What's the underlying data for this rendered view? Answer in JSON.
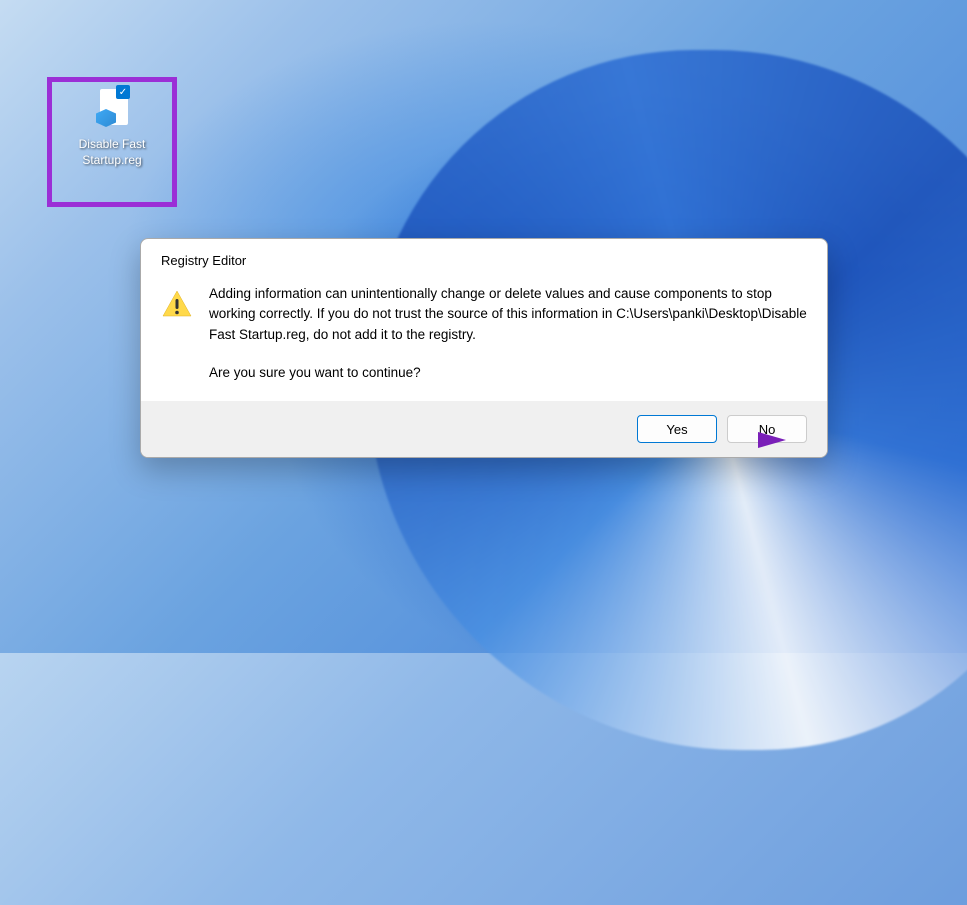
{
  "desktop": {
    "icon": {
      "label": "Disable Fast Startup.reg",
      "name": "reg-file-icon"
    }
  },
  "dialog": {
    "title": "Registry Editor",
    "warning_text": "Adding information can unintentionally change or delete values and cause components to stop working correctly. If you do not trust the source of this information in C:\\Users\\panki\\Desktop\\Disable Fast Startup.reg, do not add it to the registry.",
    "confirm_text": "Are you sure you want to continue?",
    "buttons": {
      "yes": "Yes",
      "no": "No"
    }
  }
}
